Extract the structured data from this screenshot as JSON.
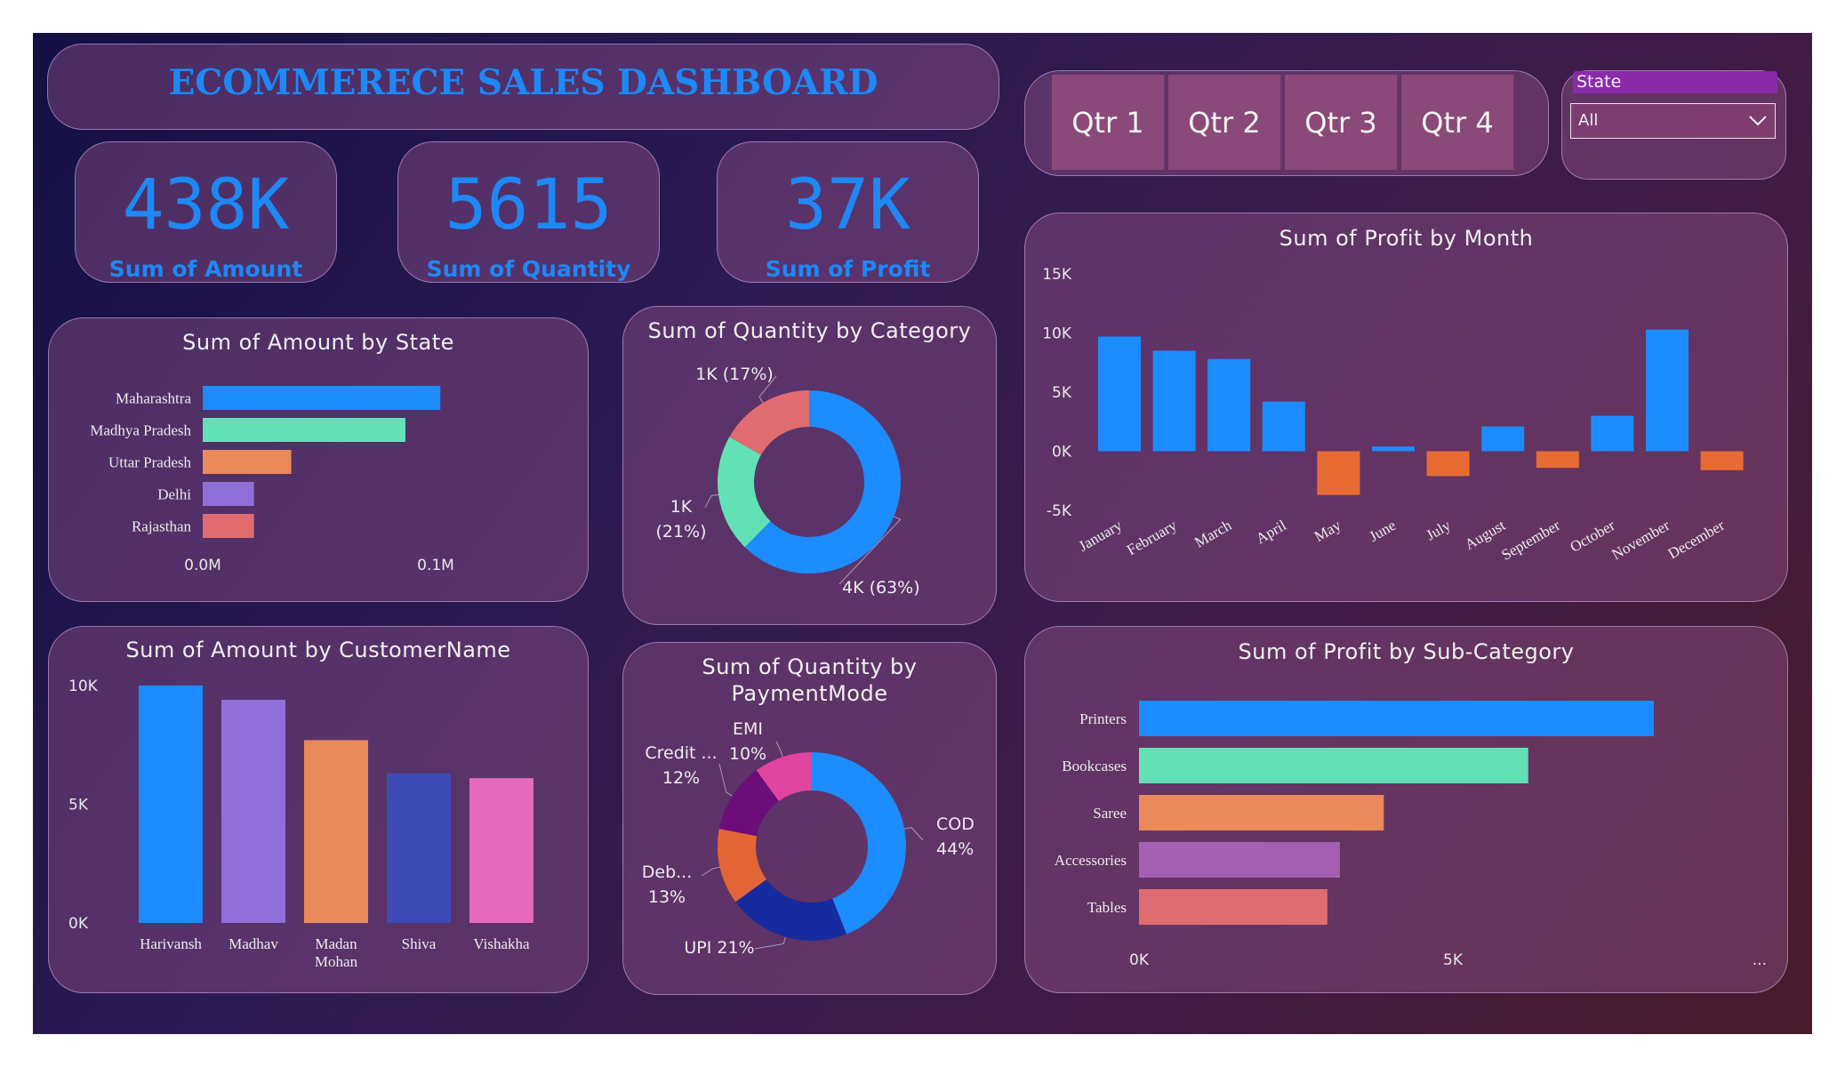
{
  "header": {
    "title_part1": "ECOMMERECE",
    "title_part2": "SALES DASHBOARD"
  },
  "kpis": [
    {
      "value": "438K",
      "label": "Sum of Amount"
    },
    {
      "value": "5615",
      "label": "Sum of Quantity"
    },
    {
      "value": "37K",
      "label": "Sum of Profit"
    }
  ],
  "slicer": {
    "quarters": [
      "Qtr 1",
      "Qtr 2",
      "Qtr 3",
      "Qtr 4"
    ],
    "state_label": "State",
    "state_value": "All"
  },
  "colors": {
    "blue": "#1c8cff",
    "teal": "#62e1b6",
    "orange": "#ea8a5b",
    "violet": "#8f6fd8",
    "salmon": "#e06b70",
    "neg": "#e86b34",
    "navy": "#172ba0",
    "purple": "#6b0e7a",
    "pink": "#e0459f",
    "brand": "#1e88f7"
  },
  "chart_data": [
    {
      "id": "amount_by_state",
      "type": "bar",
      "orientation": "horizontal",
      "title": "Sum of Amount by State",
      "categories": [
        "Maharashtra",
        "Madhya Pradesh",
        "Uttar Pradesh",
        "Delhi",
        "Rajasthan"
      ],
      "values": [
        0.102,
        0.087,
        0.038,
        0.022,
        0.022
      ],
      "xlim": [
        0,
        0.1
      ],
      "xticks": [
        0,
        0.1
      ],
      "xtick_labels": [
        "0.0M",
        "0.1M"
      ]
    },
    {
      "id": "quantity_by_category",
      "type": "pie",
      "donut": true,
      "title": "Sum of Quantity by Category",
      "values": [
        63,
        21,
        17
      ],
      "labels": [
        "4K (63%)",
        "1K (21%)",
        "1K (17%)"
      ]
    },
    {
      "id": "profit_by_month",
      "type": "bar",
      "title": "Sum of Profit by Month",
      "categories": [
        "January",
        "February",
        "March",
        "April",
        "May",
        "June",
        "July",
        "August",
        "September",
        "October",
        "November",
        "December"
      ],
      "values": [
        9700,
        8500,
        7800,
        4200,
        -3700,
        400,
        -2100,
        2100,
        -1400,
        3000,
        10300,
        -1600
      ],
      "ylim": [
        -5000,
        15000
      ],
      "yticks": [
        -5000,
        0,
        5000,
        10000,
        15000
      ],
      "ytick_labels": [
        "-5K",
        "0K",
        "5K",
        "10K",
        "15K"
      ]
    },
    {
      "id": "amount_by_customer",
      "type": "bar",
      "title": "Sum of Amount by CustomerName",
      "categories": [
        "Harivansh",
        "Madhav",
        "Madan Mohan",
        "Shiva",
        "Vishakha"
      ],
      "values": [
        10000,
        9400,
        7700,
        6300,
        6100
      ],
      "ylim": [
        0,
        10000
      ],
      "yticks": [
        0,
        5000,
        10000
      ],
      "ytick_labels": [
        "0K",
        "5K",
        "10K"
      ]
    },
    {
      "id": "quantity_by_payment",
      "type": "pie",
      "donut": true,
      "title": "Sum of Quantity by PaymentMode",
      "values": [
        44,
        21,
        13,
        12,
        10
      ],
      "labels": [
        "COD 44%",
        "UPI 21%",
        "Deb... 13%",
        "Credit ... 12%",
        "EMI 10%"
      ]
    },
    {
      "id": "profit_by_subcategory",
      "type": "bar",
      "orientation": "horizontal",
      "title": "Sum of Profit by Sub-Category",
      "categories": [
        "Printers",
        "Bookcases",
        "Saree",
        "Accessories",
        "Tables"
      ],
      "values": [
        8200,
        6200,
        3900,
        3200,
        3000
      ],
      "xlim": [
        0,
        5000
      ],
      "xticks": [
        0,
        5000
      ],
      "xtick_labels": [
        "0K",
        "5K"
      ],
      "more_label": "..."
    }
  ]
}
